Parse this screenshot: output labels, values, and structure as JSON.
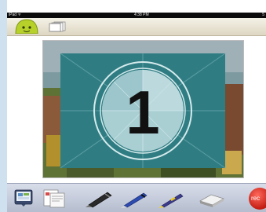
{
  "status_bar": {
    "carrier": "iPad ᯤ",
    "time": "4:38 PM",
    "battery": "5"
  },
  "toolbar": {
    "tools": [
      {
        "name": "whiteboard-thumbnail-icon"
      },
      {
        "name": "document-import-icon"
      },
      {
        "name": "black-marker-icon"
      },
      {
        "name": "blue-pen-icon"
      },
      {
        "name": "yellow-highlighter-icon"
      },
      {
        "name": "eraser-icon"
      }
    ],
    "record_label": "rec"
  },
  "countdown": {
    "digit": "1"
  },
  "colors": {
    "leader_teal": "#2f7d83",
    "circle_inner": "#a9cfd3",
    "rec_red": "#d92518"
  }
}
